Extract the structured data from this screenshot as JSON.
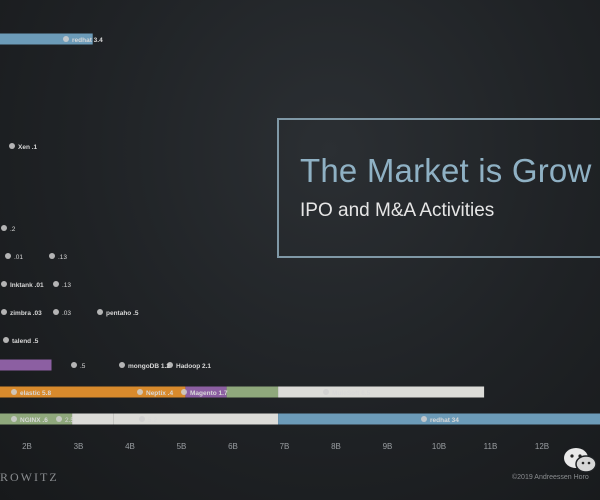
{
  "chart_data": {
    "type": "bar",
    "xlim": [
      1.2,
      12.6
    ],
    "x_ticks": [
      "2B",
      "3B",
      "4B",
      "5B",
      "6B",
      "7B",
      "8B",
      "9B",
      "10B",
      "11B",
      "12B"
    ],
    "x_tick_values": [
      2,
      3,
      4,
      5,
      6,
      7,
      8,
      9,
      10,
      11,
      12
    ],
    "rows": [
      {
        "y": 39,
        "value": 1.8,
        "color": "#6c9bb8",
        "labels": [
          {
            "name": "redhat",
            "value": "3.4",
            "logo": "redhat-logo"
          }
        ]
      },
      {
        "y": 146,
        "value": 0,
        "color": "#6c9bb8",
        "labels": [
          {
            "name": "Xen",
            "value": ".1",
            "logo": "xen-logo"
          }
        ]
      },
      {
        "y": 228,
        "value": 0,
        "color": "#6c9bb8",
        "labels": [
          {
            "name": "",
            "value": ".2",
            "logo": "cloud-logo"
          }
        ]
      },
      {
        "y": 256,
        "value": 0,
        "color": "#6c9bb8",
        "labels": [
          {
            "name": "",
            "value": ".01",
            "logo": "generic-logo"
          },
          {
            "name": "",
            "value": ".13",
            "logo": "generic-logo"
          }
        ]
      },
      {
        "y": 284,
        "value": 0,
        "color": "#6c9bb8",
        "labels": [
          {
            "name": "Inktank",
            "value": ".01",
            "logo": "inktank-logo"
          },
          {
            "name": "",
            "value": ".13",
            "logo": "generic-logo"
          }
        ]
      },
      {
        "y": 312,
        "value": 0,
        "color": "#6c9bb8",
        "labels": [
          {
            "name": "zimbra",
            "value": ".03",
            "logo": "zimbra-logo"
          },
          {
            "name": "",
            "value": ".03",
            "logo": "generic-logo"
          },
          {
            "name": "pentaho",
            "value": ".5",
            "logo": "pentaho-logo"
          }
        ]
      },
      {
        "y": 340,
        "value": 0,
        "color": "#6c9bb8",
        "labels": [
          {
            "name": "talend",
            "value": ".5",
            "logo": "talend-logo"
          }
        ]
      },
      {
        "y": 365,
        "value": 1.0,
        "color": "#8c5fa2",
        "labels": [
          {
            "name": "",
            "value": ".5",
            "logo": "generic-logo"
          },
          {
            "name": "mongoDB",
            "value": "1.2",
            "logo": "mongodb-logo"
          },
          {
            "name": "Hadoop",
            "value": "2.1",
            "logo": "hadoop-logo"
          }
        ]
      },
      {
        "y": 392,
        "value": 9.4,
        "color": "#d8d8d4",
        "segments": [
          [
            0,
            3.6,
            "#d88a2c"
          ],
          [
            3.6,
            4.4,
            "#8c5fa2"
          ],
          [
            4.4,
            5.4,
            "#8fa87c"
          ],
          [
            5.4,
            9.4,
            "#dcdcd8"
          ]
        ],
        "labels": [
          {
            "name": "elastic",
            "value": "5.8",
            "logo": "elastic-logo"
          },
          {
            "name": "Neptix",
            "value": ".4",
            "logo": "generic-logo"
          },
          {
            "name": "Magento",
            "value": "1.7",
            "logo": "magento-logo"
          },
          {
            "name": "MuleSoft",
            "value": "6.5",
            "logo": "mulesoft-logo"
          }
        ]
      },
      {
        "y": 419,
        "value": 12.6,
        "color": "#6c9bb8",
        "segments": [
          [
            0,
            1.4,
            "#8fa87c"
          ],
          [
            1.4,
            2.2,
            "#dcdcd8"
          ],
          [
            2.2,
            5.4,
            "#dcdcd8"
          ],
          [
            5.4,
            12.6,
            "#6c9bb8"
          ]
        ],
        "labels": [
          {
            "name": "NGINX",
            "value": ".6",
            "logo": "nginx-logo"
          },
          {
            "name": "",
            "value": "2.5",
            "logo": "generic-logo"
          },
          {
            "name": "",
            "value": "5.2",
            "logo": "generic-logo"
          },
          {
            "name": "redhat",
            "value": "34",
            "logo": "redhat-logo"
          }
        ]
      }
    ],
    "colors": {
      "background": "#1f2225",
      "accent": "#8fb1c4",
      "grid_text": "#9a9ea2"
    }
  },
  "callout": {
    "title": "The Market is Grow",
    "subtitle": "IPO and M&A Activities"
  },
  "footer": {
    "brand": "ROWITZ",
    "copyright": "©2019 Andreessen Horo"
  }
}
